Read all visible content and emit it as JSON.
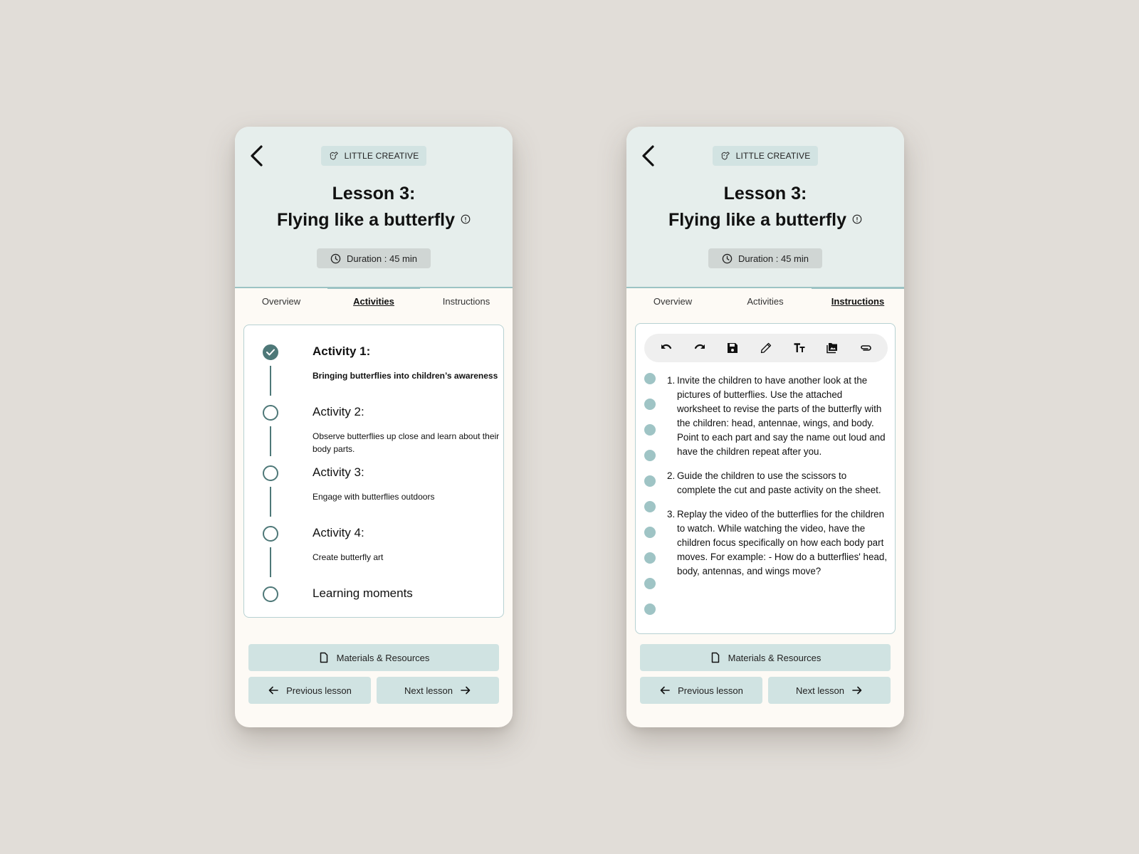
{
  "screens": [
    {
      "badge": "LITTLE CREATIVE",
      "title_line1": "Lesson 3:",
      "title_line2": "Flying like a butterfly",
      "duration": "Duration : 45 min",
      "tabs": [
        {
          "label": "Overview",
          "active": false
        },
        {
          "label": "Activities",
          "active": true
        },
        {
          "label": "Instructions",
          "active": false
        }
      ],
      "activities": [
        {
          "title": "Activity 1:",
          "description": "Bringing butterflies into children’s awareness",
          "completed": true
        },
        {
          "title": "Activity 2:",
          "description": "Observe butterflies up close and learn about their body parts.",
          "completed": false
        },
        {
          "title": "Activity 3:",
          "description": "Engage with butterflies outdoors",
          "completed": false
        },
        {
          "title": "Activity 4:",
          "description": "Create butterfly art",
          "completed": false
        },
        {
          "title": "Learning moments",
          "description": "",
          "completed": false
        }
      ],
      "buttons": {
        "materials": "Materials & Resources",
        "previous": "Previous lesson",
        "next": "Next lesson"
      }
    },
    {
      "badge": "LITTLE CREATIVE",
      "title_line1": "Lesson 3:",
      "title_line2": "Flying like a butterfly",
      "duration": "Duration : 45 min",
      "tabs": [
        {
          "label": "Overview",
          "active": false
        },
        {
          "label": "Activities",
          "active": false
        },
        {
          "label": "Instructions",
          "active": true
        }
      ],
      "toolbar": [
        "undo-icon",
        "redo-icon",
        "save-icon",
        "pencil-icon",
        "text-size-icon",
        "image-folder-icon",
        "attachment-icon"
      ],
      "instructions": [
        {
          "number": "1.",
          "text": "Invite the children to have another look at the pictures of butterflies. Use the attached worksheet to revise the parts of the butterfly with the children: head, antennae, wings, and body. Point to each part and say the name out loud and have the children repeat after you."
        },
        {
          "number": "2.",
          "text": "Guide the children to use the scissors to complete the cut and paste activity on the sheet."
        },
        {
          "number": "3.",
          "text": "Replay the video of the butterflies for the children to watch. While watching the video, have the children focus specifically on how each body part moves. For example: - How do a butterflies' head, body, antennas, and wings move?"
        }
      ],
      "buttons": {
        "materials": "Materials & Resources",
        "previous": "Previous lesson",
        "next": "Next lesson"
      }
    }
  ],
  "colors": {
    "background": "#e1ddd8",
    "header": "#e6eeec",
    "accent": "#9cc3c4",
    "dark_teal": "#4e7878",
    "button": "#d0e3e2"
  }
}
